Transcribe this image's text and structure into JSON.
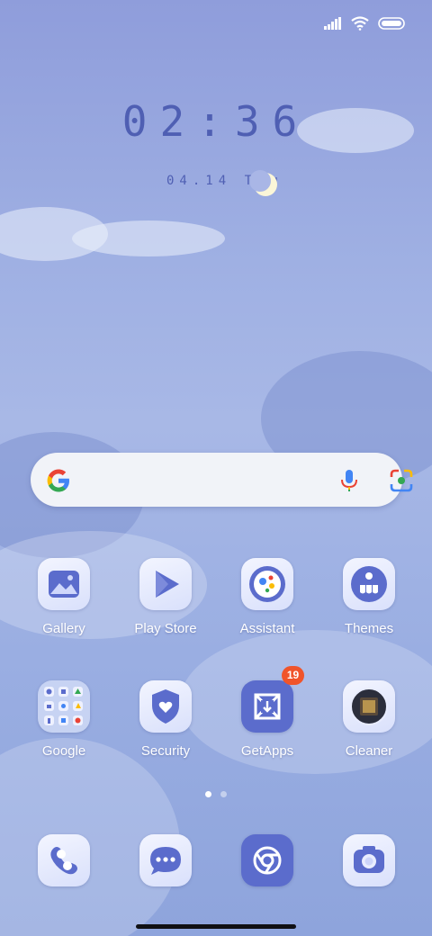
{
  "status_bar": {
    "icons": [
      "signal-icon",
      "wifi-icon",
      "battery-icon"
    ]
  },
  "clock": {
    "time": "02:36",
    "date": "04.14 Thu"
  },
  "search": {
    "icons": [
      "google-g-icon",
      "microphone-icon",
      "google-lens-icon"
    ]
  },
  "apps_row1": [
    {
      "label": "Gallery",
      "icon": "gallery-icon"
    },
    {
      "label": "Play Store",
      "icon": "play-store-icon"
    },
    {
      "label": "Assistant",
      "icon": "assistant-icon"
    },
    {
      "label": "Themes",
      "icon": "themes-icon"
    }
  ],
  "apps_row2": [
    {
      "label": "Google",
      "icon": "google-folder-icon"
    },
    {
      "label": "Security",
      "icon": "security-shield-icon"
    },
    {
      "label": "GetApps",
      "icon": "getapps-icon",
      "badge": "19"
    },
    {
      "label": "Cleaner",
      "icon": "cleaner-icon"
    }
  ],
  "page_indicator": {
    "pages": 2,
    "current": 1
  },
  "dock": [
    {
      "icon": "phone-icon"
    },
    {
      "icon": "messages-icon"
    },
    {
      "icon": "browser-icon"
    },
    {
      "icon": "camera-icon"
    }
  ],
  "colors": {
    "accent": "#4f5fb3",
    "icon_blue": "#5b6ccc",
    "badge": "#f0542b"
  }
}
